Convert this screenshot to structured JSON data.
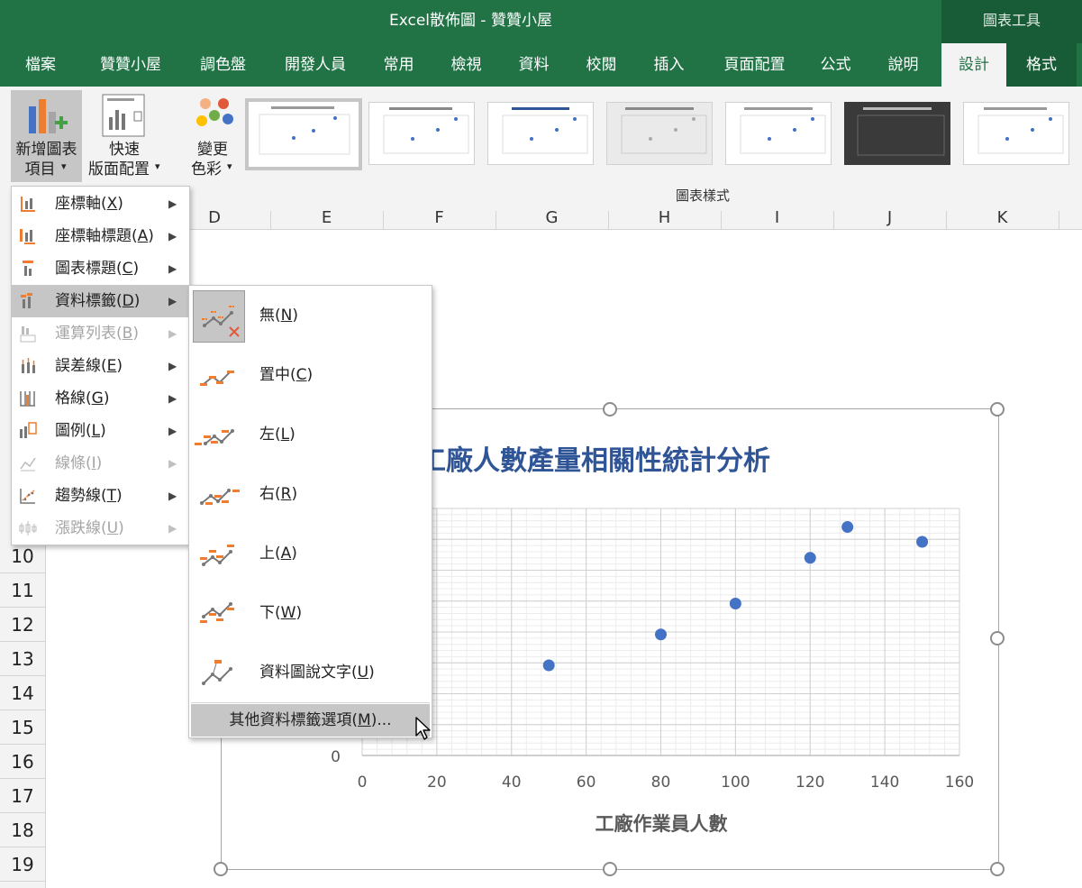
{
  "window": {
    "title": "Excel散佈圖  -  贊贊小屋",
    "context_tools": "圖表工具"
  },
  "tabs": [
    "檔案",
    "贊贊小屋",
    "調色盤",
    "開發人員",
    "常用",
    "檢視",
    "資料",
    "校閱",
    "插入",
    "頁面配置",
    "公式",
    "說明",
    "設計",
    "格式"
  ],
  "active_tab": "設計",
  "ribbon": {
    "add_element": {
      "line1": "新增圖表",
      "line2": "項目",
      "caret": "▾"
    },
    "quick_layout": {
      "line1": "快速",
      "line2": "版面配置",
      "caret": "▾"
    },
    "change_colors": {
      "line1": "變更",
      "line2": "色彩",
      "caret": "▾"
    },
    "chart_styles_group": "圖表樣式"
  },
  "columns": [
    "D",
    "E",
    "F",
    "G",
    "H",
    "I",
    "J",
    "K"
  ],
  "rows": [
    "10",
    "11",
    "12",
    "13",
    "14",
    "15",
    "16",
    "17",
    "18",
    "19"
  ],
  "menu": {
    "items": [
      {
        "label": "座標軸",
        "key": "X",
        "enabled": true,
        "icon": "axes-icon"
      },
      {
        "label": "座標軸標題",
        "key": "A",
        "enabled": true,
        "icon": "axis-titles-icon"
      },
      {
        "label": "圖表標題",
        "key": "C",
        "enabled": true,
        "icon": "chart-title-icon"
      },
      {
        "label": "資料標籤",
        "key": "D",
        "enabled": true,
        "icon": "data-labels-icon",
        "highlighted": true
      },
      {
        "label": "運算列表",
        "key": "B",
        "enabled": false,
        "icon": "data-table-icon"
      },
      {
        "label": "誤差線",
        "key": "E",
        "enabled": true,
        "icon": "error-bars-icon"
      },
      {
        "label": "格線",
        "key": "G",
        "enabled": true,
        "icon": "gridlines-icon"
      },
      {
        "label": "圖例",
        "key": "L",
        "enabled": true,
        "icon": "legend-icon"
      },
      {
        "label": "線條",
        "key": "I",
        "enabled": false,
        "icon": "lines-icon"
      },
      {
        "label": "趨勢線",
        "key": "T",
        "enabled": true,
        "icon": "trendline-icon"
      },
      {
        "label": "漲跌線",
        "key": "U",
        "enabled": false,
        "icon": "up-down-bars-icon"
      }
    ]
  },
  "submenu": {
    "items": [
      {
        "label": "無",
        "key": "N",
        "selected": true
      },
      {
        "label": "置中",
        "key": "C"
      },
      {
        "label": "左",
        "key": "L"
      },
      {
        "label": "右",
        "key": "R"
      },
      {
        "label": "上",
        "key": "A"
      },
      {
        "label": "下",
        "key": "W"
      },
      {
        "label": "資料圖說文字",
        "key": "U"
      }
    ],
    "more_options": {
      "label": "其他資料標籤選項",
      "key": "M",
      "suffix": "..."
    }
  },
  "colors": {
    "excel_green": "#217346",
    "title_blue": "#2f5597",
    "marker_blue": "#4472c4"
  },
  "chart_data": {
    "type": "scatter",
    "title": "工廠人數產量相關性統計分析",
    "xlabel": "工廠作業員人數",
    "ylabel": "",
    "xlim": [
      0,
      160
    ],
    "xticks": [
      0,
      20,
      40,
      60,
      80,
      100,
      120,
      140,
      160
    ],
    "ylim": [
      0,
      1000
    ],
    "yticks_visible": [
      0
    ],
    "points": [
      {
        "x": 50,
        "y": 365
      },
      {
        "x": 80,
        "y": 490
      },
      {
        "x": 100,
        "y": 615
      },
      {
        "x": 120,
        "y": 800
      },
      {
        "x": 130,
        "y": 925
      },
      {
        "x": 150,
        "y": 865
      }
    ],
    "grid": true
  }
}
